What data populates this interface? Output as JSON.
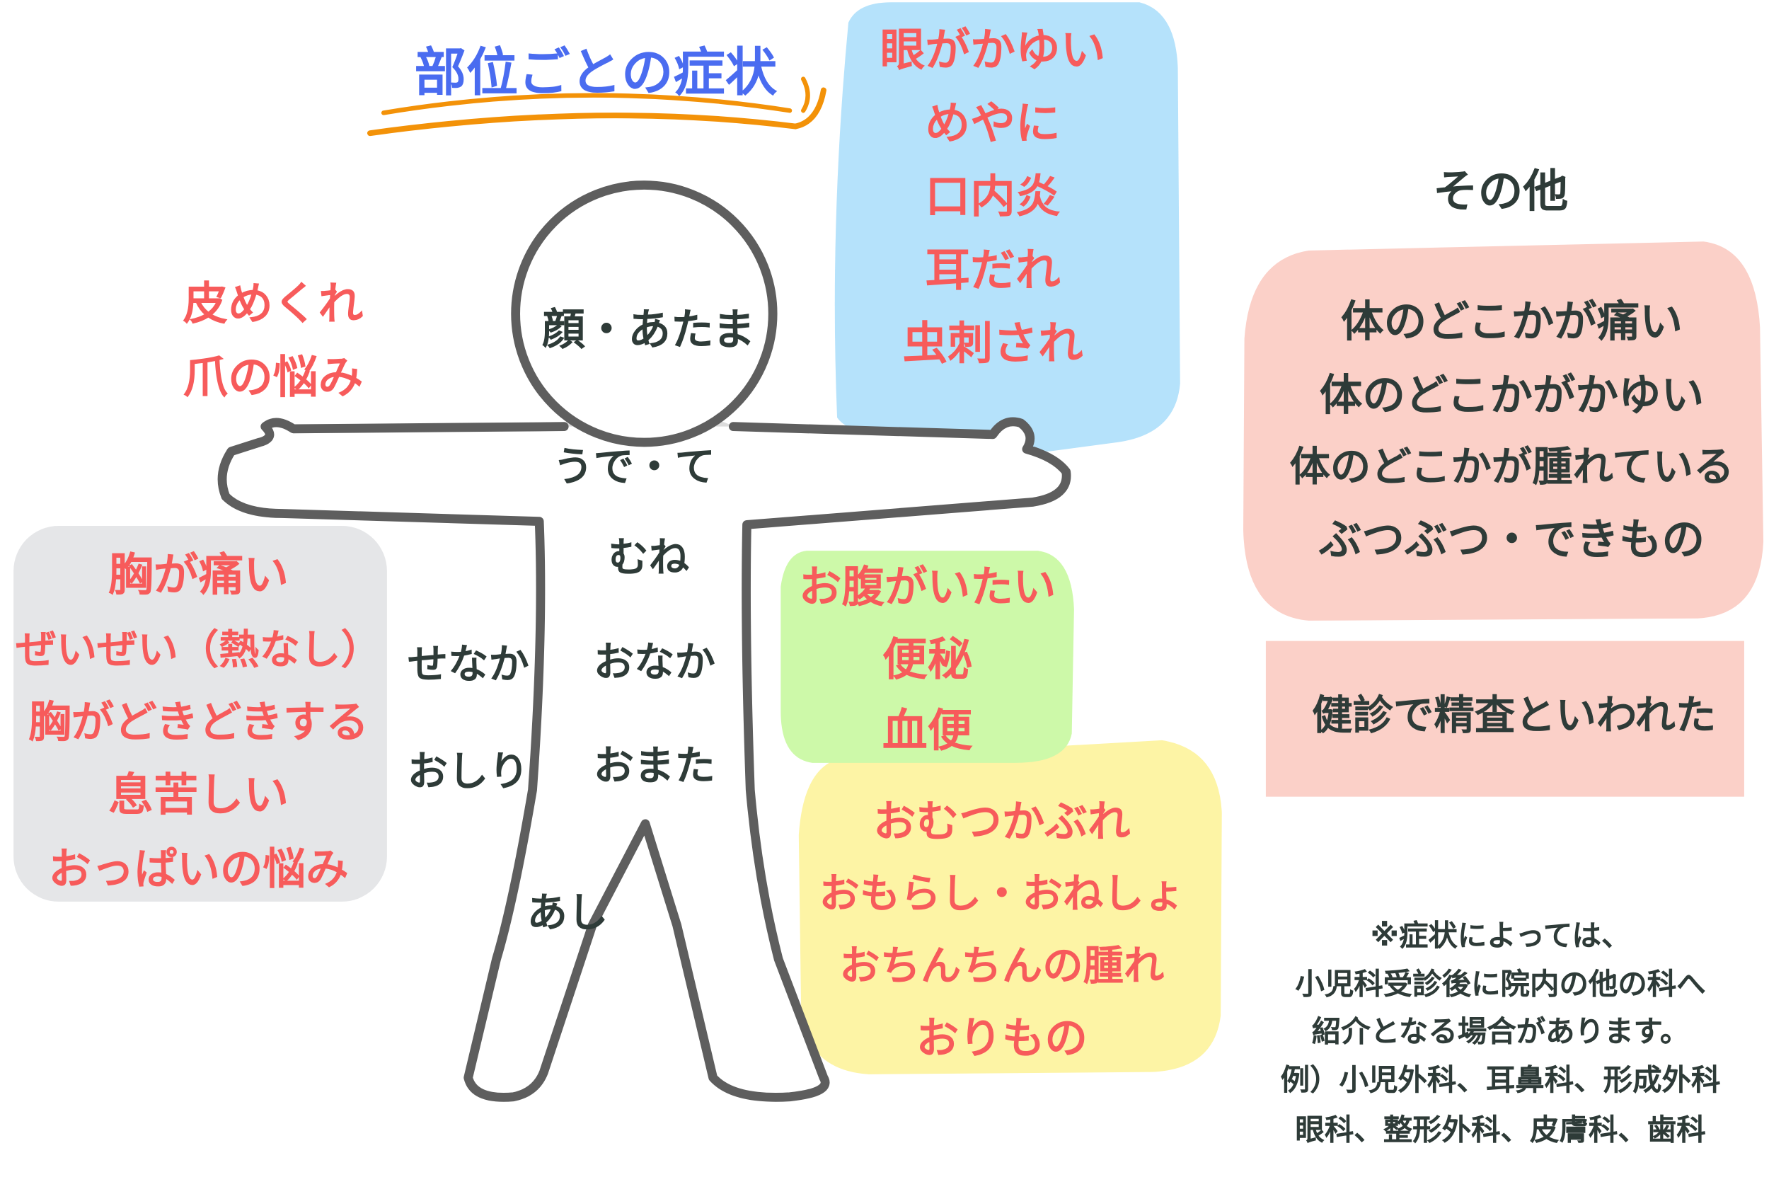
{
  "title": "部位ごとの症状",
  "colors": {
    "red": "#f75b5b",
    "dark": "#2e3b38",
    "title": "#4a6cf0",
    "underline": "#f39208",
    "blue_box": "#b5e2fb",
    "green_box": "#cdf9a9",
    "yellow_box": "#fdf4a5",
    "pink_box": "#fbd0c8",
    "gray_box": "#e5e6e8"
  },
  "head_box": {
    "items": [
      "眼がかゆい",
      "めやに",
      "口内炎",
      "耳だれ",
      "虫刺され"
    ]
  },
  "skin": {
    "items": [
      "皮めくれ",
      "爪の悩み"
    ]
  },
  "chest_box": {
    "items": [
      "胸が痛い",
      "ぜいぜい（熱なし）",
      "胸がどきどきする",
      "息苦しい",
      "おっぱいの悩み"
    ]
  },
  "belly_box": {
    "items": [
      "お腹がいたい",
      "便秘",
      "血便"
    ]
  },
  "groin_box": {
    "items": [
      "おむつかぶれ",
      "おもらし・おねしょ",
      "おちんちんの腫れ",
      "おりもの"
    ]
  },
  "body_labels": {
    "face": "顔・あたま",
    "arm": "うで・て",
    "chest": "むね",
    "back": "せなか",
    "belly": "おなか",
    "buttocks": "おしり",
    "groin": "おまた",
    "leg": "あし"
  },
  "other": {
    "heading": "その他",
    "items": [
      "体のどこかが痛い",
      "体のどこかがかゆい",
      "体のどこかが腫れている",
      "ぶつぶつ・できもの"
    ],
    "checkup": "健診で精査といわれた"
  },
  "note": {
    "lines": [
      "※症状によっては、",
      "小児科受診後に院内の他の科へ",
      "紹介となる場合があります。",
      "例）小児外科、耳鼻科、形成外科",
      "眼科、整形外科、皮膚科、歯科"
    ]
  }
}
